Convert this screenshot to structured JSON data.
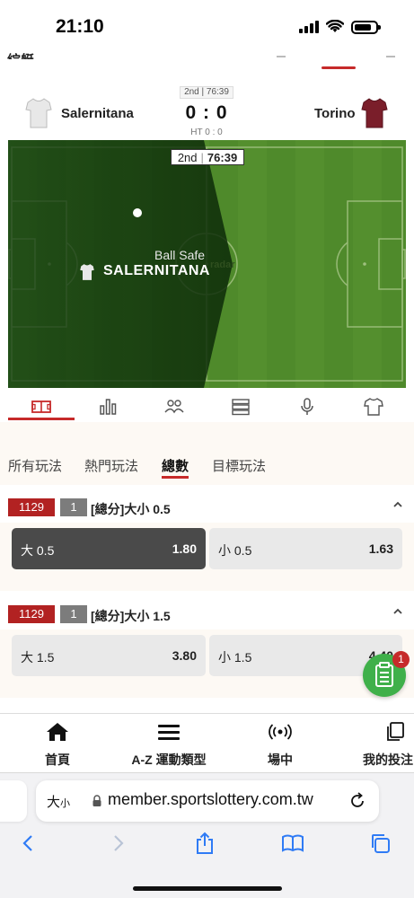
{
  "status_bar": {
    "time": "21:10"
  },
  "page_header": {
    "cut_title": "綜艇"
  },
  "match": {
    "period_clock": "2nd | 76:39",
    "home_team": "Salernitana",
    "away_team": "Torino",
    "score": "0 : 0",
    "halftime": "HT 0 : 0",
    "home_jersey_color": "#e8e8e8",
    "away_jersey_color": "#7a1e2a"
  },
  "pitch": {
    "period": "2nd",
    "clock": "76:39",
    "status": "Ball Safe",
    "team_in_possession": "SALERNITANA",
    "watermark": "radar"
  },
  "icon_tabs": [
    {
      "name": "field-icon"
    },
    {
      "name": "stats-bar-icon"
    },
    {
      "name": "lineup-icon"
    },
    {
      "name": "list-icon"
    },
    {
      "name": "microphone-icon"
    },
    {
      "name": "jersey-icon"
    }
  ],
  "bet_tabs": [
    {
      "label": "所有玩法"
    },
    {
      "label": "熱門玩法"
    },
    {
      "label": "總數"
    },
    {
      "label": "目標玩法"
    }
  ],
  "markets": [
    {
      "code": "1129",
      "num": "1",
      "title": "[總分]大小 0.5",
      "over_label": "大 0.5",
      "over_odds": "1.80",
      "under_label": "小 0.5",
      "under_odds": "1.63"
    },
    {
      "code": "1129",
      "num": "1",
      "title": "[總分]大小 1.5",
      "over_label": "大 1.5",
      "over_odds": "3.80",
      "under_label": "小 1.5",
      "under_odds": "4.40"
    }
  ],
  "bet_slip": {
    "count": "1"
  },
  "bottom_nav": [
    {
      "label": "首頁"
    },
    {
      "label": "A-Z 運動類型"
    },
    {
      "label": "場中"
    },
    {
      "label": "我的投注"
    }
  ],
  "browser": {
    "text_size_big": "大",
    "text_size_small": "小",
    "url": "member.sportslottery.com.tw"
  },
  "colors": {
    "accent_red": "#c62a2a",
    "code_red": "#b22222",
    "selected_odd": "#4a4a4a",
    "fab_green": "#3fb04a"
  }
}
